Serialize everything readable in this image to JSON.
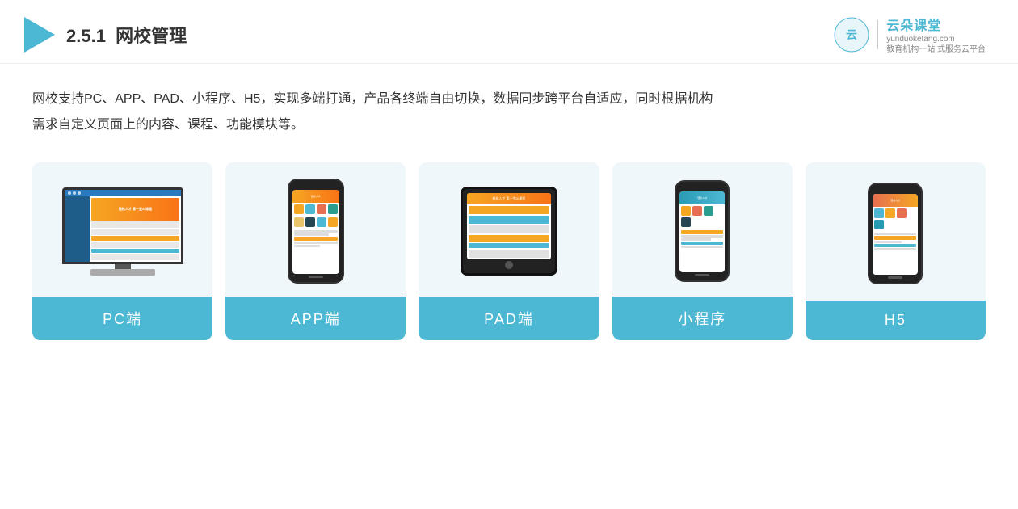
{
  "header": {
    "section_number": "2.5.1",
    "title_plain": "网校管理",
    "logo_icon_text": "云",
    "brand_name": "云朵课堂",
    "brand_url": "yunduoketang.com",
    "brand_slogan_line1": "教育机构一站",
    "brand_slogan_line2": "式服务云平台"
  },
  "description": {
    "line1": "网校支持PC、APP、PAD、小程序、H5，实现多端打通，产品各终端自由切换，数据同步跨平台自适应，同时根据机构",
    "line2": "需求自定义页面上的内容、课程、功能模块等。"
  },
  "cards": [
    {
      "id": "pc",
      "label": "PC端",
      "type": "pc"
    },
    {
      "id": "app",
      "label": "APP端",
      "type": "phone"
    },
    {
      "id": "pad",
      "label": "PAD端",
      "type": "tablet"
    },
    {
      "id": "mini",
      "label": "小程序",
      "type": "phone"
    },
    {
      "id": "h5",
      "label": "H5",
      "type": "phone"
    }
  ],
  "colors": {
    "teal": "#4db8d4",
    "teal_bg": "#f0f7fb",
    "orange": "#f5a623"
  }
}
